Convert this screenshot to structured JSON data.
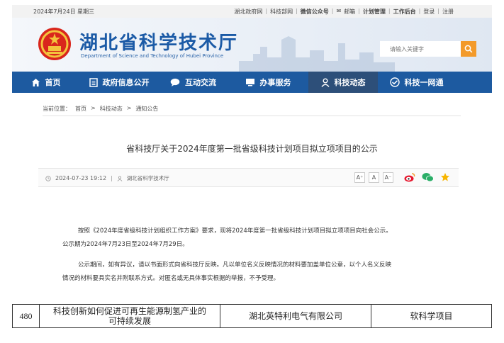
{
  "topbar": {
    "date": "2024年7月24日 星期三",
    "links": [
      "湖北政府网",
      "科技部网",
      "微信公众号",
      "邮箱",
      "计划管理",
      "工作后台",
      "登录",
      "注册"
    ]
  },
  "header": {
    "title": "湖北省科学技术厅",
    "subtitle": "Department of Science and Technology of Hubei Province",
    "search_placeholder": "请输入关键字"
  },
  "nav": [
    {
      "label": "首页",
      "icon": "home-icon"
    },
    {
      "label": "政府信息公开",
      "icon": "document-icon"
    },
    {
      "label": "互动交流",
      "icon": "chat-icon"
    },
    {
      "label": "办事服务",
      "icon": "monitor-icon"
    },
    {
      "label": "科技动态",
      "icon": "person-icon",
      "active": true
    },
    {
      "label": "科技一网通",
      "icon": "eye-icon"
    }
  ],
  "breadcrumb": {
    "prefix": "当前位置：",
    "items": [
      "首页",
      "科技动态",
      "通知公告"
    ],
    "separator": ">"
  },
  "article": {
    "title": "省科技厅关于2024年度第一批省级科技计划项目拟立项项目的公示",
    "datetime": "2024-07-23 19:12",
    "source": "湖北省科学技术厅",
    "font_sizes": [
      "A⁺",
      "A",
      "A⁻"
    ],
    "paragraphs": [
      "按照《2024年度省级科技计划组织工作方案》要求，现将2024年度第一批省级科技计划项目拟立项项目向社会公示。",
      "公示期为2024年7月23日至2024年7月29日。",
      "公示期间，如有异议，请以书面形式向省科技厅反映。凡以单位名义反映情况的材料要加盖单位公章，以个人名义反映",
      "情况的材料要具实名并附联系方式。对匿名或无具体事实根据的举报，不予受理。"
    ]
  },
  "table": {
    "rows": [
      {
        "no": "480",
        "project_line1": "科技创新如何促进可再生能源制氢产业的",
        "project_line2": "可持续发展",
        "org": "湖北英特利电气有限公司",
        "category": "软科学项目"
      }
    ]
  },
  "colors": {
    "nav_bg": "#1d5aa0",
    "nav_active": "#2d4f79",
    "title_blue": "#1b5aa6",
    "search_btn": "#f39a2a"
  }
}
